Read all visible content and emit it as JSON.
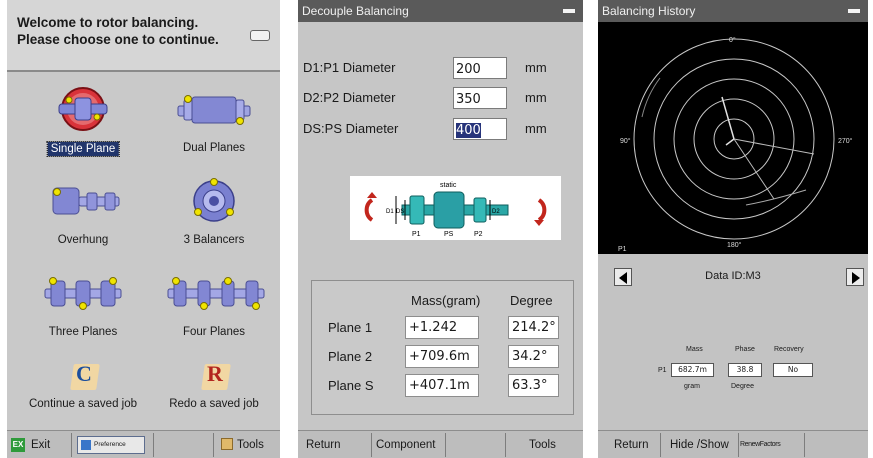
{
  "panel1": {
    "welcome_line1": "Welcome to rotor balancing.",
    "welcome_line2": "Please choose one to continue.",
    "modes": {
      "single_plane": "Single Plane",
      "dual_planes": "Dual Planes",
      "overhung": "Overhung",
      "three_balancers": "3 Balancers",
      "three_planes": "Three Planes",
      "four_planes": "Four Planes",
      "continue_job": "Continue a saved job",
      "redo_job": "Redo a saved job"
    },
    "continue_icon_letter": "C",
    "redo_icon_letter": "R",
    "footer": {
      "exit": "Exit",
      "preference": "Preference",
      "tools": "Tools"
    },
    "icons": [
      "exit-icon",
      "preference-icon",
      "tools-icon",
      "rotor-icon",
      "wheel-icon",
      "document-icon"
    ],
    "colors": {
      "selection": "#21356b",
      "yellow_marker": "#f0e400",
      "rotor": "#6d6fc9"
    }
  },
  "panel2": {
    "title": "Decouple Balancing",
    "fields": [
      {
        "label": "D1:P1 Diameter",
        "value": "200",
        "unit": "mm"
      },
      {
        "label": "D2:P2 Diameter",
        "value": "350",
        "unit": "mm"
      },
      {
        "label": "DS:PS Diameter",
        "value": "400",
        "unit": "mm"
      }
    ],
    "diagram": {
      "static": "static",
      "d1": "D1",
      "ds": "DS",
      "d2": "D2",
      "p1": "P1",
      "ps": "PS",
      "p2": "P2"
    },
    "results_header": {
      "mass": "Mass(gram)",
      "degree": "Degree"
    },
    "results": [
      {
        "plane": "Plane 1",
        "mass": "+1.242",
        "degree": "214.2°"
      },
      {
        "plane": "Plane 2",
        "mass": "+709.6m",
        "degree": "34.2°"
      },
      {
        "plane": "Plane S",
        "mass": "+407.1m",
        "degree": "63.3°"
      }
    ],
    "footer": {
      "return": "Return",
      "component": "Component",
      "tools": "Tools"
    }
  },
  "panel3": {
    "title": "Balancing History",
    "polar": {
      "top": "0°",
      "left": "90°",
      "right": "270°",
      "bottom": "180°",
      "plane": "P1"
    },
    "data_id": "Data ID:M3",
    "table": {
      "mass": "Mass",
      "phase": "Phase",
      "recovery": "Recovery",
      "row": "P1",
      "mass_value": "682.7m",
      "phase_value": "38.8",
      "recovery_value": "No",
      "mass_unit": "gram",
      "phase_unit": "Degree"
    },
    "footer": {
      "return": "Return",
      "hide_show": "Hide /Show",
      "renew": "RenewFactors"
    }
  }
}
